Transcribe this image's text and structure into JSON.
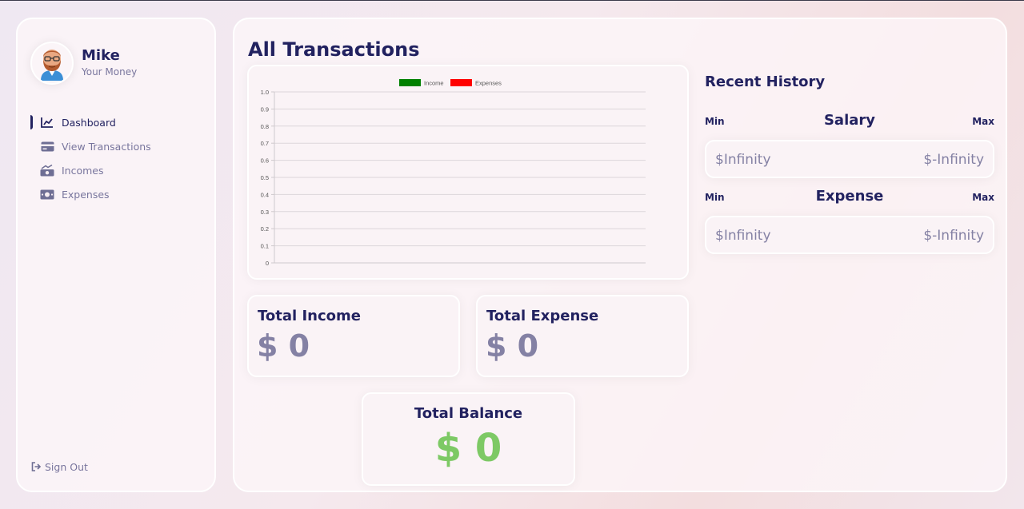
{
  "sidebar": {
    "profile": {
      "name": "Mike",
      "subtitle": "Your Money"
    },
    "menu": [
      {
        "label": "Dashboard",
        "icon": "chart-line-icon",
        "active": true
      },
      {
        "label": "View Transactions",
        "icon": "credit-card-icon",
        "active": false
      },
      {
        "label": "Incomes",
        "icon": "money-bill-trend-icon",
        "active": false
      },
      {
        "label": "Expenses",
        "icon": "money-bill-icon",
        "active": false
      }
    ],
    "signout": {
      "label": "Sign Out",
      "icon": "sign-out-icon"
    }
  },
  "main": {
    "title": "All Transactions",
    "total_income": {
      "label": "Total Income",
      "value": "$ 0"
    },
    "total_expense": {
      "label": "Total Expense",
      "value": "$ 0"
    },
    "total_balance": {
      "label": "Total Balance",
      "value": "$ 0"
    }
  },
  "history": {
    "title": "Recent History",
    "salary": {
      "min_label": "Min",
      "title": "Salary",
      "max_label": "Max",
      "min_value": "$Infinity",
      "max_value": "$-Infinity"
    },
    "expense": {
      "min_label": "Min",
      "title": "Expense",
      "max_label": "Max",
      "min_value": "$Infinity",
      "max_value": "$-Infinity"
    }
  },
  "colors": {
    "primary": "#222260",
    "balance_green": "#7dc965",
    "income_series": "#008000",
    "expense_series": "#ff0000"
  },
  "chart_data": {
    "type": "line",
    "categories": [],
    "series": [
      {
        "name": "Income",
        "color": "#008000",
        "values": []
      },
      {
        "name": "Expenses",
        "color": "#ff0000",
        "values": []
      }
    ],
    "ylim": [
      0,
      1.0
    ],
    "yticks": [
      "1.0",
      "0.9",
      "0.8",
      "0.7",
      "0.6",
      "0.5",
      "0.4",
      "0.3",
      "0.2",
      "0.1",
      "0"
    ],
    "legend": "top",
    "grid": true
  }
}
